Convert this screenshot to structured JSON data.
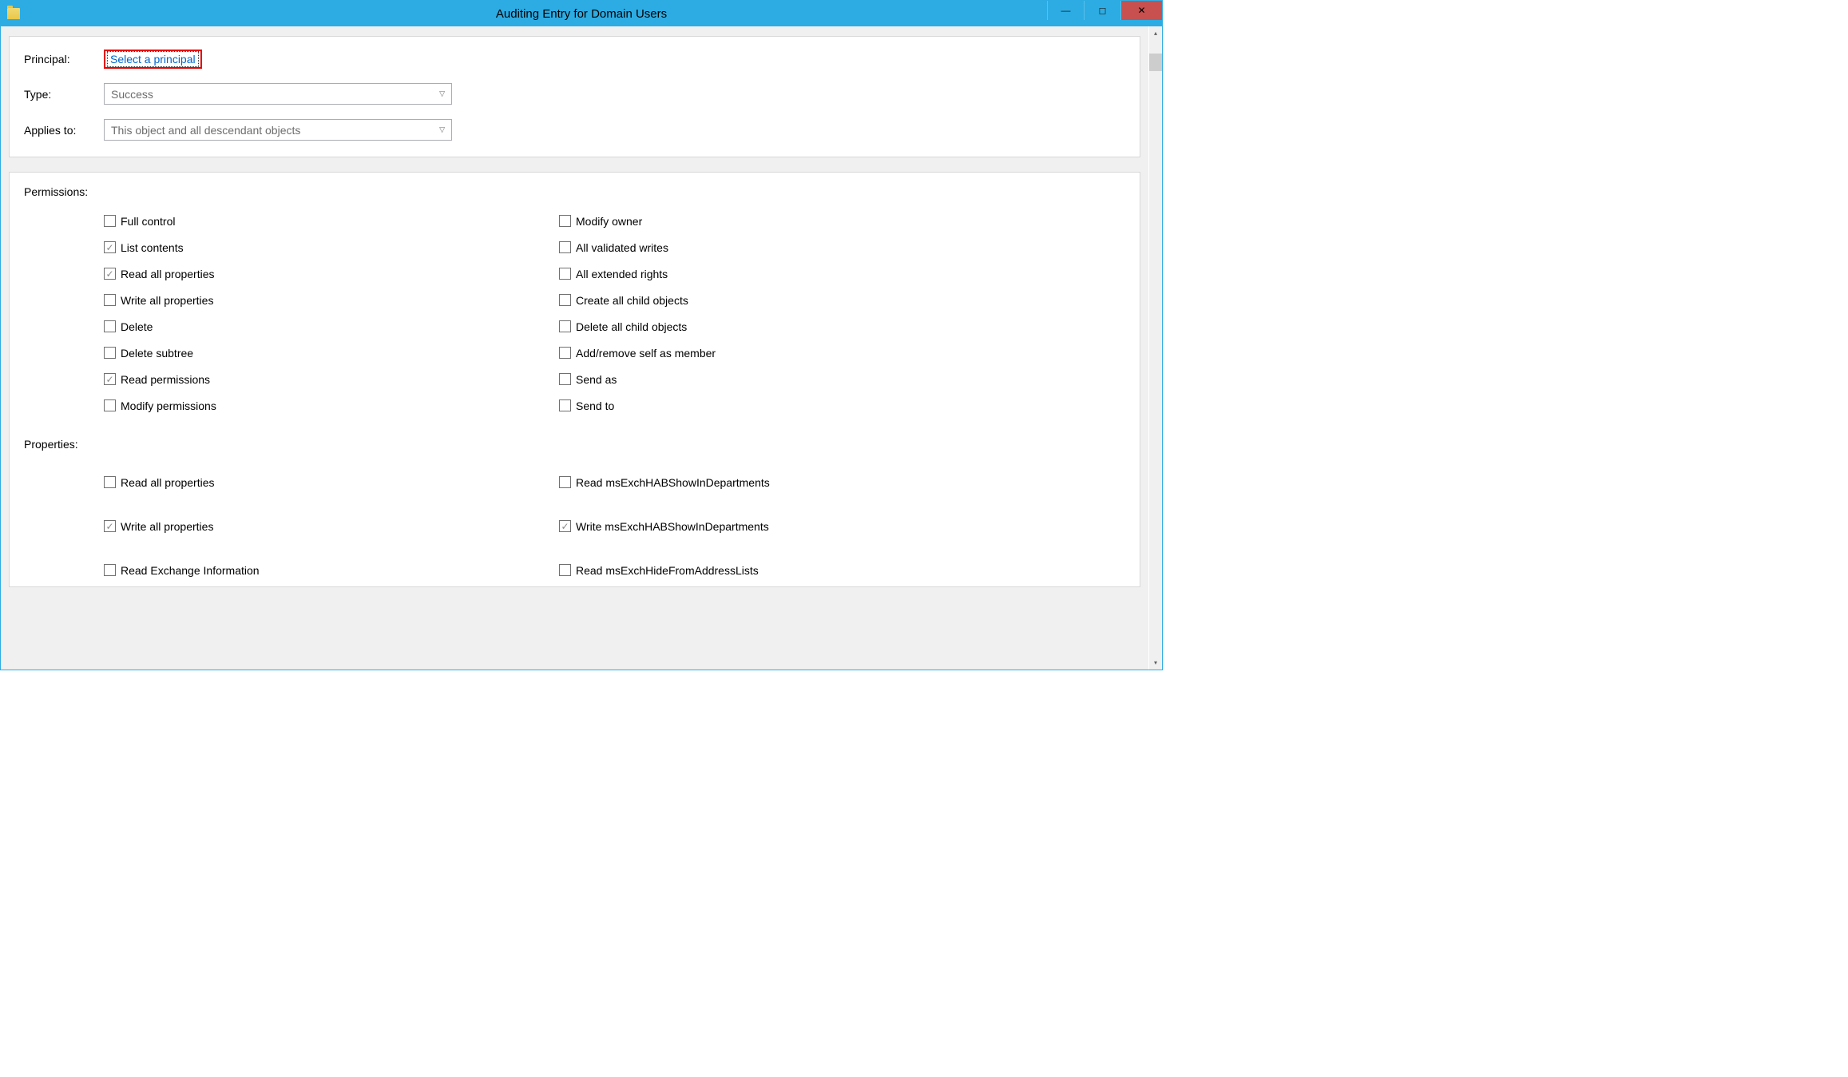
{
  "window": {
    "title": "Auditing Entry for Domain Users"
  },
  "form": {
    "principal_label": "Principal:",
    "principal_link": "Select a principal",
    "type_label": "Type:",
    "type_value": "Success",
    "applies_label": "Applies to:",
    "applies_value": "This object and all descendant objects"
  },
  "permissions_header": "Permissions:",
  "permissions_left": [
    {
      "label": "Full control",
      "checked": false
    },
    {
      "label": "List contents",
      "checked": true
    },
    {
      "label": "Read all properties",
      "checked": true
    },
    {
      "label": "Write all properties",
      "checked": false
    },
    {
      "label": "Delete",
      "checked": false
    },
    {
      "label": "Delete subtree",
      "checked": false
    },
    {
      "label": "Read permissions",
      "checked": true
    },
    {
      "label": "Modify permissions",
      "checked": false
    }
  ],
  "permissions_right": [
    {
      "label": "Modify owner",
      "checked": false
    },
    {
      "label": "All validated writes",
      "checked": false
    },
    {
      "label": "All extended rights",
      "checked": false
    },
    {
      "label": "Create all child objects",
      "checked": false
    },
    {
      "label": "Delete all child objects",
      "checked": false
    },
    {
      "label": "Add/remove self as member",
      "checked": false
    },
    {
      "label": "Send as",
      "checked": false
    },
    {
      "label": "Send to",
      "checked": false
    }
  ],
  "properties_header": "Properties:",
  "properties_left": [
    {
      "label": "Read all properties",
      "checked": false
    },
    {
      "label": "Write all properties",
      "checked": true
    },
    {
      "label": "Read Exchange Information",
      "checked": false
    }
  ],
  "properties_right": [
    {
      "label": "Read msExchHABShowInDepartments",
      "checked": false
    },
    {
      "label": "Write msExchHABShowInDepartments",
      "checked": true
    },
    {
      "label": "Read msExchHideFromAddressLists",
      "checked": false
    }
  ]
}
